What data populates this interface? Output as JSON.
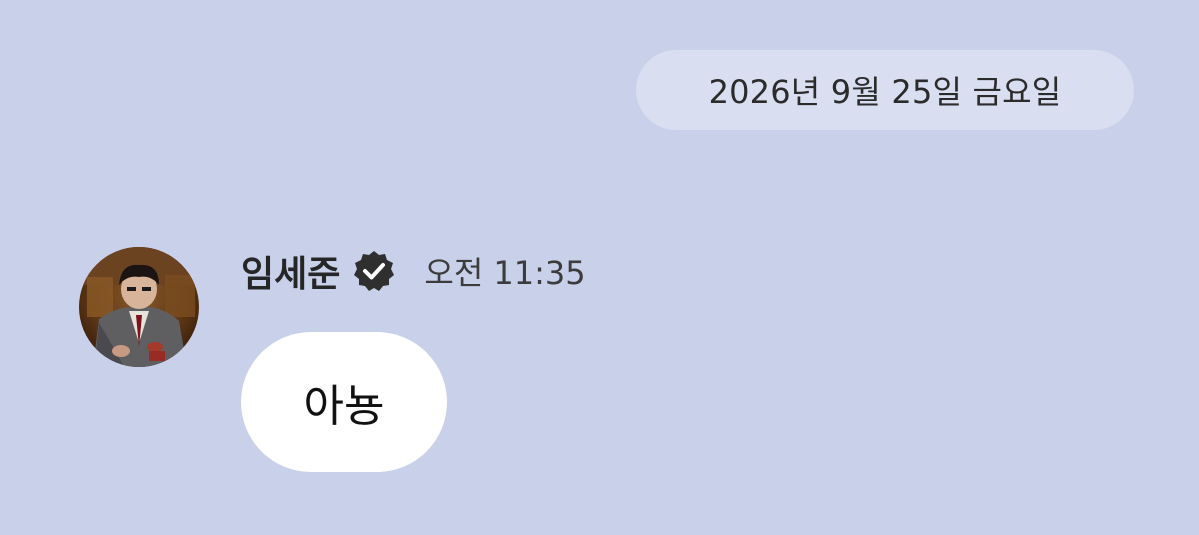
{
  "date_separator": {
    "label": "2026년 9월 25일 금요일"
  },
  "message": {
    "sender": {
      "name": "임세준",
      "verified": true,
      "avatar_icon": "profile-photo"
    },
    "time": "오전 11:35",
    "text": "아뇽"
  },
  "colors": {
    "background": "#c9d0ea",
    "date_pill": "#d9def0",
    "bubble": "#ffffff",
    "verified_badge": "#2f2f2f"
  }
}
